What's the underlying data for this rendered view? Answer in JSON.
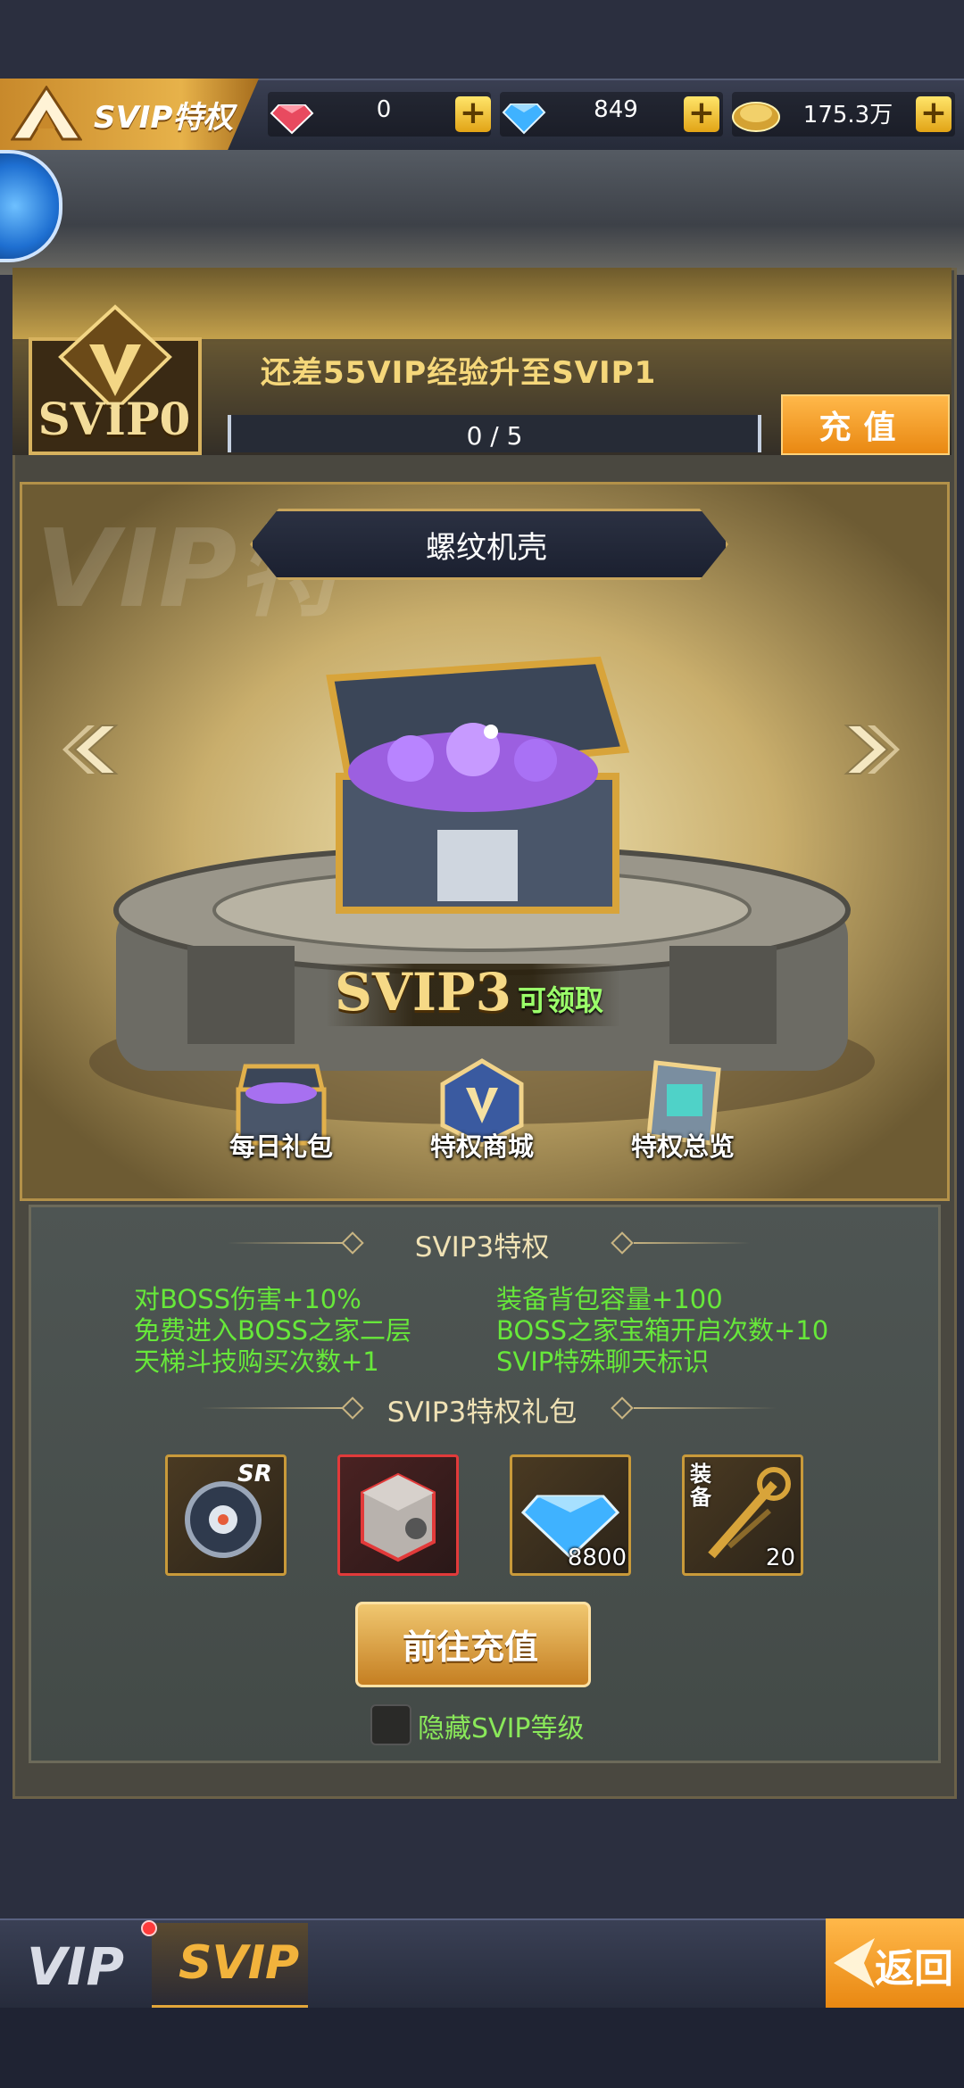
{
  "header": {
    "title": "SVIP特权",
    "resources": [
      {
        "icon": "red-gem-icon",
        "value": "0"
      },
      {
        "icon": "blue-diamond-icon",
        "value": "849"
      },
      {
        "icon": "gold-coin-icon",
        "value": "175.3万"
      }
    ],
    "plus_label": "+"
  },
  "svip": {
    "current_level": "SVIP0",
    "upgrade_message": "还差55VIP经验升至SVIP1",
    "progress_text": "0 / 5",
    "progress_value": 0,
    "recharge_label": "充值"
  },
  "showcase": {
    "watermark": "VIP特",
    "item_name": "螺纹机壳",
    "level_tag": "SVIP3",
    "claimable": "可领取",
    "features": [
      {
        "label": "每日礼包",
        "icon": "gift-chest-icon"
      },
      {
        "label": "特权商城",
        "icon": "vip-shop-icon"
      },
      {
        "label": "特权总览",
        "icon": "privilege-overview-icon"
      }
    ]
  },
  "privileges": {
    "title": "SVIP3特权",
    "perks": [
      "对BOSS伤害+10%",
      "装备背包容量+100",
      "免费进入BOSS之家二层",
      "BOSS之家宝箱开启次数+10",
      "天梯斗技购买次数+1",
      "SVIP特殊聊天标识"
    ]
  },
  "gifts": {
    "title": "SVIP3特权礼包",
    "items": [
      {
        "icon": "sr-mecha-gear-icon",
        "quantity": "",
        "badge": "SR"
      },
      {
        "icon": "red-cube-box-icon",
        "quantity": ""
      },
      {
        "icon": "blue-diamond-icon",
        "quantity": "8800"
      },
      {
        "icon": "equipment-key-icon",
        "quantity": "20",
        "badge": "装备"
      }
    ],
    "goto_recharge_label": "前往充值",
    "hide_label": "隐藏SVIP等级"
  },
  "bottom_nav": {
    "tab_vip": "VIP",
    "tab_svip": "SVIP",
    "back_label": "返回"
  },
  "colors": {
    "accent_gold": "#e7b24a",
    "perk_green": "#67e83a",
    "claimable_green": "#9bff6a",
    "panel_dark": "#434a47"
  }
}
